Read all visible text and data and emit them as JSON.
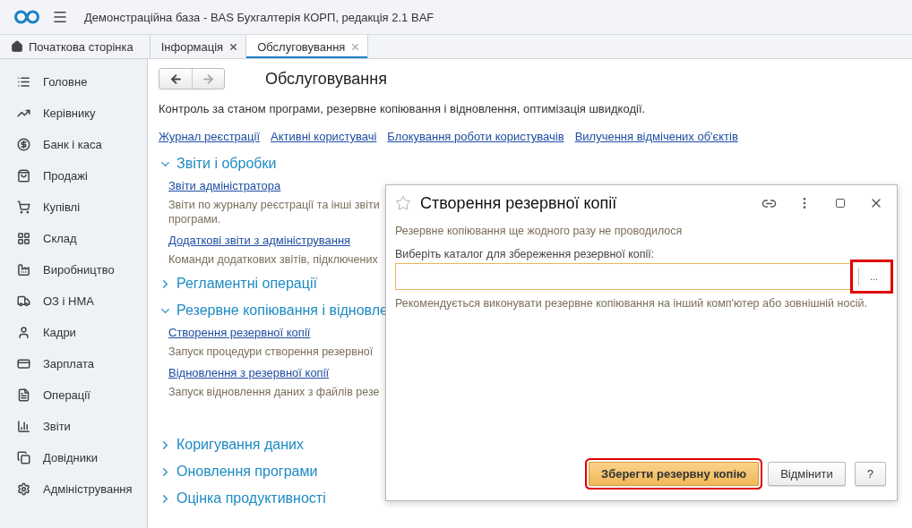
{
  "window": {
    "title": "Демонстраційна база - BAS Бухгалтерія КОРП, редакція 2.1 BAF"
  },
  "tabs": [
    {
      "label": "Початкова сторінка",
      "kind": "home",
      "selected": false
    },
    {
      "label": "Інформація",
      "kind": "closable",
      "selected": false
    },
    {
      "label": "Обслуговування",
      "kind": "closable",
      "selected": true
    }
  ],
  "sidebar": {
    "items": [
      {
        "label": "Головне",
        "kind": "list"
      },
      {
        "label": "Керівнику",
        "kind": "trend"
      },
      {
        "label": "Банк і каса",
        "kind": "coin"
      },
      {
        "label": "Продажі",
        "kind": "bag"
      },
      {
        "label": "Купівлі",
        "kind": "cart"
      },
      {
        "label": "Склад",
        "kind": "grid"
      },
      {
        "label": "Виробництво",
        "kind": "factory"
      },
      {
        "label": "ОЗ і НМА",
        "kind": "truck"
      },
      {
        "label": "Кадри",
        "kind": "person"
      },
      {
        "label": "Зарплата",
        "kind": "card"
      },
      {
        "label": "Операції",
        "kind": "ledger"
      },
      {
        "label": "Звіти",
        "kind": "chart"
      },
      {
        "label": "Довідники",
        "kind": "copy"
      },
      {
        "label": "Адміністрування",
        "kind": "gear"
      }
    ]
  },
  "page": {
    "title": "Обслуговування",
    "description": "Контроль за станом програми, резервне копіювання і відновлення, оптимізація швидкодії.",
    "links": [
      "Журнал реєстрації",
      "Активні користувачі",
      "Блокування роботи користувачів",
      "Вилучення відмічених об'єктів"
    ],
    "sections": [
      {
        "title": "Звіти і обробки",
        "expanded": true,
        "items": [
          {
            "link": "Звіти адміністратора",
            "description": "Звіти по журналу реєстрації та інші звіти",
            "description_2": "програми."
          },
          {
            "link": "Додаткові звіти з адміністрування",
            "description": "Команди додаткових звітів, підключених"
          }
        ]
      },
      {
        "title": "Регламентні операції",
        "expanded": false
      },
      {
        "title": "Резервне копіювання і відновле",
        "expanded": true,
        "items": [
          {
            "link": "Створення резервної копії",
            "description": "Запуск процедури створення резервної"
          },
          {
            "link": "Відновлення з резервної копії",
            "description": "Запуск відновлення даних з файлів резе"
          }
        ]
      },
      {
        "title": "Коригування даних",
        "expanded": false
      },
      {
        "title": "Оновлення програми",
        "expanded": false
      },
      {
        "title": "Оцінка продуктивності",
        "expanded": false
      }
    ]
  },
  "dialog": {
    "title": "Створення резервної копії",
    "favorite": false,
    "status": "Резервне копіювання ще жодного разу не проводилося",
    "field_label": "Виберіть каталог для збереження резервної копії:",
    "select_button": "...",
    "select_highlighted": true,
    "hint": "Рекомендується виконувати резервне копіювання на інший комп'ютер або зовнішній носій.",
    "buttons": [
      {
        "label": "Зберегти резервну копію",
        "kind": "primary",
        "highlighted": true
      },
      {
        "label": "Відмінити",
        "kind": "normal",
        "highlighted": false
      },
      {
        "label": "?",
        "kind": "normal",
        "highlighted": false
      }
    ]
  }
}
